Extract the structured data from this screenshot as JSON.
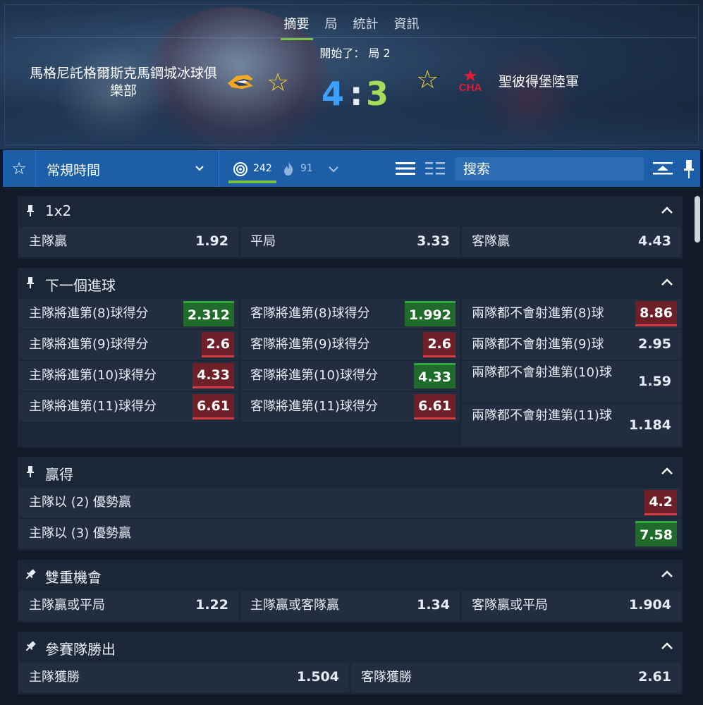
{
  "header": {
    "tabs": [
      "摘要",
      "局",
      "統計",
      "資訊"
    ],
    "status": "開始了： 局 2",
    "home_team": "馬格尼託格爾斯克馬鋼城冰球俱樂部",
    "away_team": "聖彼得堡陸軍",
    "away_logo_text": "CHA",
    "score_home": "4",
    "score_sep": ":",
    "score_away": "3"
  },
  "toolbar": {
    "period": "常規時間",
    "count_markets": "242",
    "count_hot": "91",
    "search_placeholder": "搜索"
  },
  "sections": {
    "s1": {
      "title": "1x2",
      "home_label": "主隊贏",
      "home_odd": "1.92",
      "draw_label": "平局",
      "draw_odd": "3.33",
      "away_label": "客隊贏",
      "away_odd": "4.43"
    },
    "s2": {
      "title": "下一個進球",
      "r1c1_label": "主隊將進第(8)球得分",
      "r1c1_odd": "2.312",
      "r1c2_label": "客隊將進第(8)球得分",
      "r1c2_odd": "1.992",
      "r1c3_label": "兩隊都不會射進第(8)球",
      "r1c3_odd": "8.86",
      "r2c1_label": "主隊將進第(9)球得分",
      "r2c1_odd": "2.6",
      "r2c2_label": "客隊將進第(9)球得分",
      "r2c2_odd": "2.6",
      "r2c3_label": "兩隊都不會射進第(9)球",
      "r2c3_odd": "2.95",
      "r3c1_label": "主隊將進第(10)球得分",
      "r3c1_odd": "4.33",
      "r3c2_label": "客隊將進第(10)球得分",
      "r3c2_odd": "4.33",
      "r3c3_label": "兩隊都不會射進第(10)球",
      "r3c3_odd": "1.59",
      "r4c1_label": "主隊將進第(11)球得分",
      "r4c1_odd": "6.61",
      "r4c2_label": "客隊將進第(11)球得分",
      "r4c2_odd": "6.61",
      "r4c3_label": "兩隊都不會射進第(11)球",
      "r4c3_odd": "1.184"
    },
    "s3": {
      "title": "贏得",
      "r1_label": "主隊以 (2) 優勢贏",
      "r1_odd": "4.2",
      "r2_label": "主隊以 (3) 優勢贏",
      "r2_odd": "7.58"
    },
    "s4": {
      "title": "雙重機會",
      "c1_label": "主隊贏或平局",
      "c1_odd": "1.22",
      "c2_label": "主隊贏或客隊贏",
      "c2_odd": "1.34",
      "c3_label": "客隊贏或平局",
      "c3_odd": "1.904"
    },
    "s5": {
      "title": "參賽隊勝出",
      "c1_label": "主隊獲勝",
      "c1_odd": "1.504",
      "c2_label": "客隊獲勝",
      "c2_odd": "2.61"
    }
  },
  "colors": {
    "accent_green": "#7cc242",
    "toolbar_blue": "#1c5fa8",
    "odds_up": "#1e6b2a",
    "odds_down": "#6f1f27",
    "score_home": "#3ca0ff",
    "score_away": "#a6dc5a",
    "star": "#f2d22e"
  },
  "icons": {
    "favorite": "star-icon",
    "period_dropdown": "chevron-down-icon",
    "markets": "target-icon",
    "hot": "flame-icon",
    "view_list": "list-icon",
    "view_compact": "compact-list-icon",
    "collapse_all": "collapse-all-icon",
    "pin": "pin-icon",
    "section_toggle": "chevron-up-icon"
  }
}
